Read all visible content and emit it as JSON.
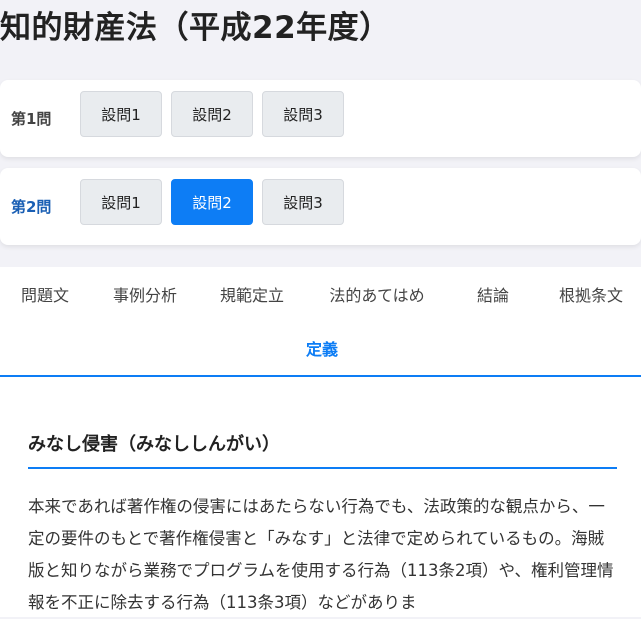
{
  "page": {
    "title": "知的財産法（平成22年度）"
  },
  "questions": [
    {
      "label": "第1問",
      "active": false,
      "subquestions": [
        "設問1",
        "設問2",
        "設問3"
      ],
      "selected_index": null
    },
    {
      "label": "第2問",
      "active": true,
      "subquestions": [
        "設問1",
        "設問2",
        "設問3"
      ],
      "selected_index": 1
    }
  ],
  "tabs": {
    "items": [
      "問題文",
      "事例分析",
      "規範定立",
      "法的あてはめ",
      "結論",
      "根拠条文",
      "定義"
    ],
    "active": "定義"
  },
  "content": {
    "heading": "みなし侵害（みなししんがい）",
    "body": "本来であれば著作権の侵害にはあたらない行為でも、法政策的な観点から、一定の要件のもとで著作権侵害と「みなす」と法律で定められているもの。海賊版と知りながら業務でプログラムを使用する行為（113条2項）や、権利管理情報を不正に除去する行為（113条3項）などがありま"
  },
  "colors": {
    "accent": "#0d7df5",
    "background": "#f2f2f7",
    "button_idle": "#e9ecef"
  }
}
